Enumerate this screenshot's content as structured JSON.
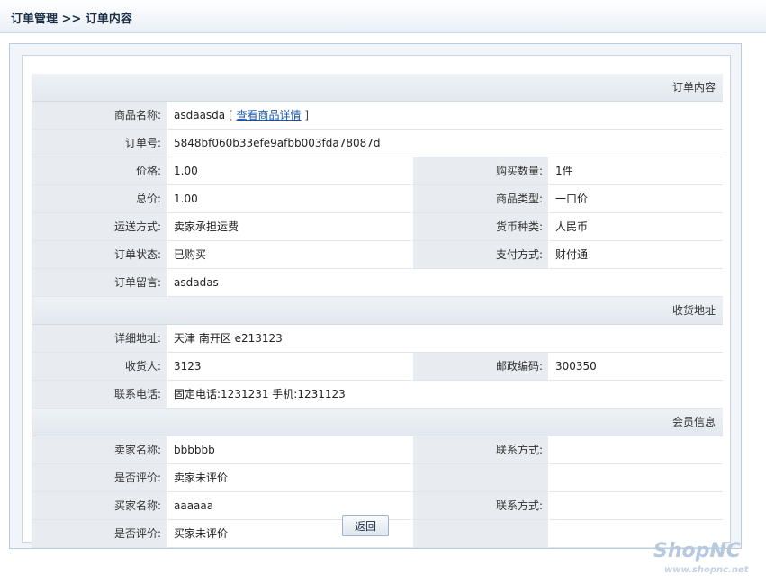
{
  "header": {
    "breadcrumb": "订单管理 >> 订单内容"
  },
  "sections": {
    "order": "订单内容",
    "address": "收货地址",
    "member": "会员信息"
  },
  "order": {
    "product_name_label": "商品名称:",
    "product_name": "asdaasda",
    "view_detail_open": "[",
    "view_detail_link": "查看商品详情",
    "view_detail_close": "]",
    "order_no_label": "订单号:",
    "order_no": "5848bf060b33efe9afbb003fda78087d",
    "price_label": "价格:",
    "price": "1.00",
    "qty_label": "购买数量:",
    "qty": "1件",
    "total_label": "总价:",
    "total": "1.00",
    "type_label": "商品类型:",
    "type": "一口价",
    "shipping_label": "运送方式:",
    "shipping": "卖家承担运费",
    "currency_label": "货币种类:",
    "currency": "人民币",
    "status_label": "订单状态:",
    "status": "已购买",
    "payment_label": "支付方式:",
    "payment": "财付通",
    "message_label": "订单留言:",
    "message": "asdadas"
  },
  "address": {
    "detail_label": "详细地址:",
    "detail": "天津 南开区 e213123",
    "receiver_label": "收货人:",
    "receiver": "3123",
    "zip_label": "邮政编码:",
    "zip": "300350",
    "phone_label": "联系电话:",
    "phone": "固定电话:1231231 手机:1231123"
  },
  "member": {
    "seller_label": "卖家名称:",
    "seller": "bbbbbb",
    "seller_contact_label": "联系方式:",
    "seller_contact": "",
    "seller_rated_label": "是否评价:",
    "seller_rated": "卖家未评价",
    "buyer_label": "买家名称:",
    "buyer": "aaaaaa",
    "buyer_contact_label": "联系方式:",
    "buyer_contact": "",
    "buyer_rated_label": "是否评价:",
    "buyer_rated": "买家未评价"
  },
  "actions": {
    "back_label": "返回"
  },
  "brand": {
    "name": "ShopNC",
    "url": "www.shopnc.net"
  }
}
